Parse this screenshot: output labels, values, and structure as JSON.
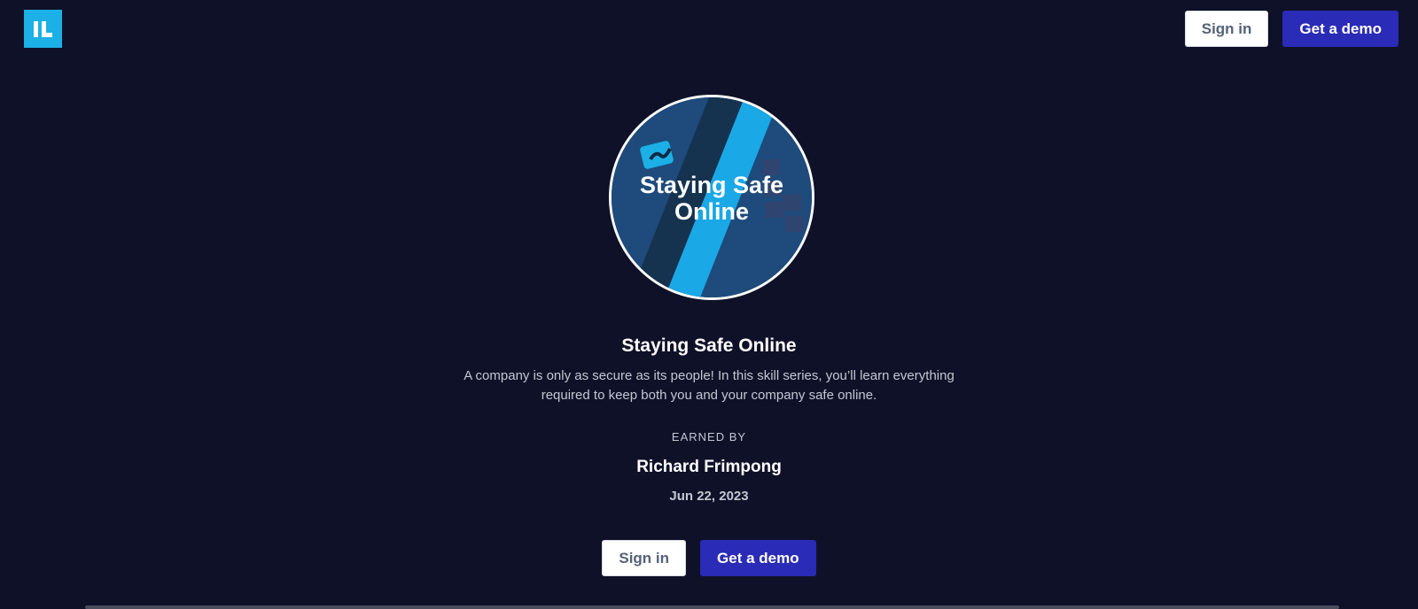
{
  "header": {
    "logo_text": "IL",
    "sign_in_label": "Sign in",
    "demo_label": "Get a demo"
  },
  "badge": {
    "image_title_line1": "Staying Safe",
    "image_title_line2": "Online",
    "icon": "shield-s-icon"
  },
  "main": {
    "title": "Staying Safe Online",
    "description": "A company is only as secure as its people! In this skill series, you’ll learn everything required to keep both you and your company safe online.",
    "earned_by_label": "EARNED BY",
    "earner_name": "Richard Frimpong",
    "date": "Jun 22, 2023"
  },
  "footer_actions": {
    "sign_in_label": "Sign in",
    "demo_label": "Get a demo"
  },
  "colors": {
    "background": "#0f1128",
    "brand_blue": "#1bb0e6",
    "demo_button": "#2a2bb6"
  }
}
